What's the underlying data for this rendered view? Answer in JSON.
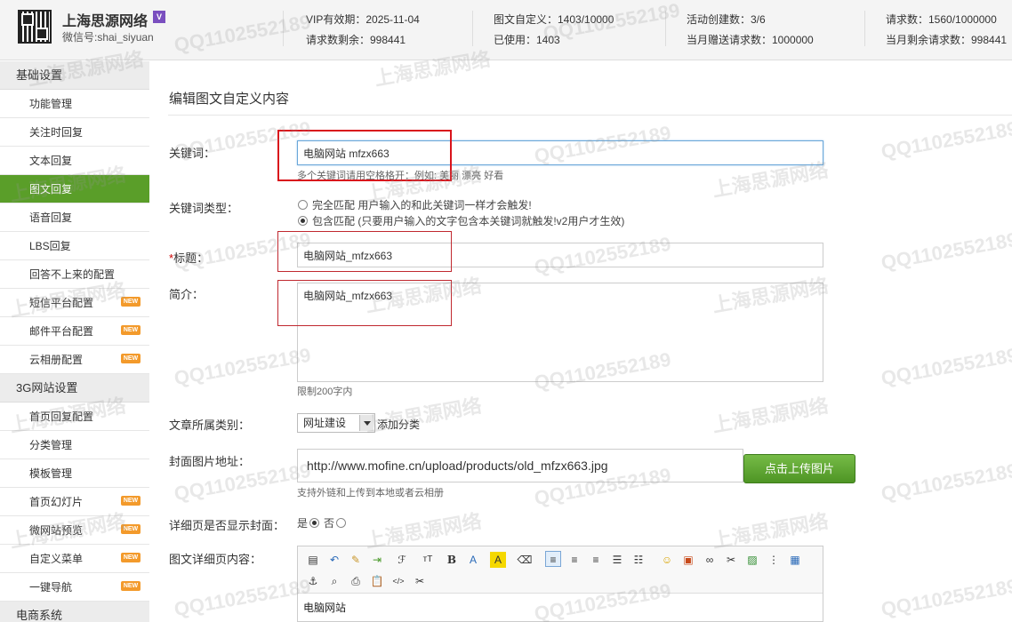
{
  "header": {
    "brand": "上海思源网络",
    "vip_badge": "V",
    "wechat": "微信号:shai_siyuan",
    "vip_expiry": "VIP有效期：2025-11-04",
    "requests_remaining": "请求数剩余：998441",
    "custom_graphics": "图文自定义：1403/10000",
    "used": "已使用：1403",
    "activities": "活动创建数：3/6",
    "monthly_gift": "当月赠送请求数：1000000",
    "requests": "请求数：1560/1000000",
    "monthly_remaining": "当月剩余请求数：998441"
  },
  "watermark": {
    "qq": "QQ1102552189",
    "name": "上海思源网络"
  },
  "sidebar": {
    "section1": "基础设置",
    "items1": [
      {
        "label": "功能管理"
      },
      {
        "label": "关注时回复"
      },
      {
        "label": "文本回复"
      },
      {
        "label": "图文回复"
      },
      {
        "label": "语音回复"
      },
      {
        "label": "LBS回复"
      },
      {
        "label": "回答不上来的配置"
      },
      {
        "label": "短信平台配置",
        "badge": "NEW"
      },
      {
        "label": "邮件平台配置",
        "badge": "NEW"
      },
      {
        "label": "云相册配置",
        "badge": "NEW"
      }
    ],
    "section2": "3G网站设置",
    "items2": [
      {
        "label": "首页回复配置"
      },
      {
        "label": "分类管理"
      },
      {
        "label": "模板管理"
      },
      {
        "label": "首页幻灯片",
        "badge": "NEW"
      },
      {
        "label": "微网站预览",
        "badge": "NEW"
      },
      {
        "label": "自定义菜单",
        "badge": "NEW"
      },
      {
        "label": "一键导航",
        "badge": "NEW"
      }
    ],
    "section3": "电商系统"
  },
  "form": {
    "title": "编辑图文自定义内容",
    "keyword_label": "关键词：",
    "keyword_value": "电脑网站 mfzx663",
    "keyword_hint": "多个关键词请用空格格开：例如: 美丽 漂亮 好看",
    "keyword_type_label": "关键词类型：",
    "match_exact": "完全匹配 用户输入的和此关键词一样才会触发!",
    "match_contains": "包含匹配 (只要用户输入的文字包含本关键词就触发!v2用户才生效)",
    "title_label": "标题：",
    "title_value": "电脑网站_mfzx663",
    "summary_label": "简介：",
    "summary_value": "电脑网站_mfzx663",
    "summary_hint": "限制200字内",
    "category_label": "文章所属类别：",
    "category_value": "网址建设",
    "add_category": "添加分类",
    "cover_label": "封面图片地址：",
    "cover_value": "http://www.mofine.cn/upload/products/old_mfzx663.jpg",
    "upload_button": "点击上传图片",
    "cover_hint": "支持外链和上传到本地或者云相册",
    "show_cover_label": "详细页是否显示封面：",
    "yes": "是",
    "no": "否",
    "detail_label": "图文详细页内容：",
    "editor_content": "电脑网站"
  },
  "toolbar": {
    "bold": "B",
    "font_size": "тT",
    "font_color": "A",
    "font_bg": "A"
  }
}
